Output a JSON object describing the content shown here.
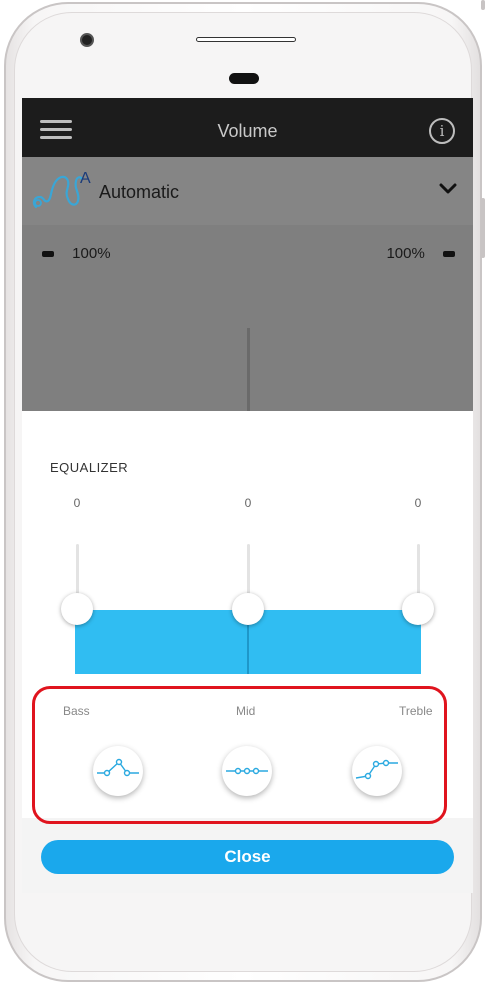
{
  "topbar": {
    "title": "Volume"
  },
  "program": {
    "name": "Automatic"
  },
  "battery": {
    "left": "100%",
    "right": "100%"
  },
  "equalizer": {
    "title": "EQUALIZER",
    "bands": [
      {
        "label": "Bass",
        "value": "0"
      },
      {
        "label": "Mid",
        "value": "0"
      },
      {
        "label": "Treble",
        "value": "0"
      }
    ]
  },
  "footer": {
    "close_label": "Close"
  },
  "colors": {
    "accent": "#1aa8ec",
    "highlight": "#e0141e",
    "topbar": "#1c1c1c"
  }
}
